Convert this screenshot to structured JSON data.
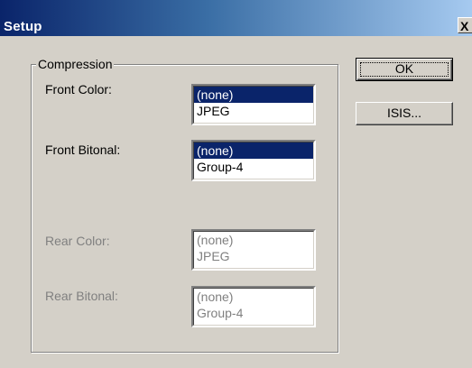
{
  "window": {
    "title": "Setup",
    "close_glyph": "X"
  },
  "compression": {
    "group_label": "Compression",
    "fields": [
      {
        "label": "Front Color:",
        "options": [
          "(none)",
          "JPEG"
        ],
        "selected": "(none)",
        "enabled": true
      },
      {
        "label": "Front Bitonal:",
        "options": [
          "(none)",
          "Group-4"
        ],
        "selected": "(none)",
        "enabled": true
      },
      {
        "label": "Rear Color:",
        "options": [
          "(none)",
          "JPEG"
        ],
        "selected": "",
        "enabled": false
      },
      {
        "label": "Rear Bitonal:",
        "options": [
          "(none)",
          "Group-4"
        ],
        "selected": "",
        "enabled": false
      }
    ]
  },
  "buttons": {
    "ok": "OK",
    "isis": "ISIS..."
  },
  "colors": {
    "selection": "#0a246a",
    "face": "#d4d0c8",
    "disabled_text": "#808080"
  }
}
